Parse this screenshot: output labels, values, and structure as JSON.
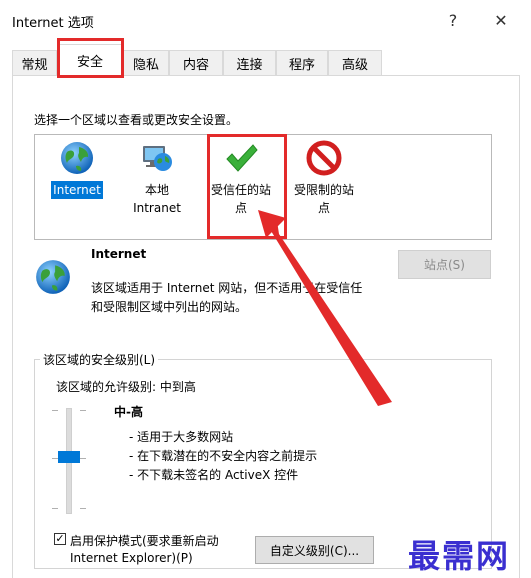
{
  "window": {
    "title": "Internet 选项",
    "help": "?",
    "close": "✕"
  },
  "tabs": [
    "常规",
    "安全",
    "隐私",
    "内容",
    "连接",
    "程序",
    "高级"
  ],
  "active_tab": "安全",
  "zone_prompt": "选择一个区域以查看或更改安全设置。",
  "zones": [
    {
      "line1": "Internet",
      "line2": "",
      "icon": "globe-icon",
      "selected": true
    },
    {
      "line1": "本地",
      "line2": "Intranet",
      "icon": "local-intranet-icon",
      "selected": false
    },
    {
      "line1": "受信任的站",
      "line2": "点",
      "icon": "green-check-icon",
      "selected": false
    },
    {
      "line1": "受限制的站",
      "line2": "点",
      "icon": "restricted-icon",
      "selected": false
    }
  ],
  "zone_info": {
    "name": "Internet",
    "desc_line1": "该区域适用于 Internet 网站，但不适用于在受信任",
    "desc_line2": "和受限制区域中列出的网站。",
    "sites_button": "站点(S)"
  },
  "security_level": {
    "group_label": "该区域的安全级别(L)",
    "allowed_label": "该区域的允许级别: 中到高",
    "level_name": "中-高",
    "bullets": [
      "- 适用于大多数网站",
      "- 在下载潜在的不安全内容之前提示",
      "- 不下载未签名的 ActiveX 控件"
    ],
    "slider_level": 0.5
  },
  "protected_mode": {
    "label_line1": "启用保护模式(要求重新启动",
    "label_line2": "Internet Explorer)(P)",
    "checked": true
  },
  "custom_level_button": "自定义级别(C)...",
  "watermark": "最需网",
  "colors": {
    "accent": "#0078d7",
    "annotation": "#e32a2a",
    "watermark": "#3a2fd0"
  }
}
